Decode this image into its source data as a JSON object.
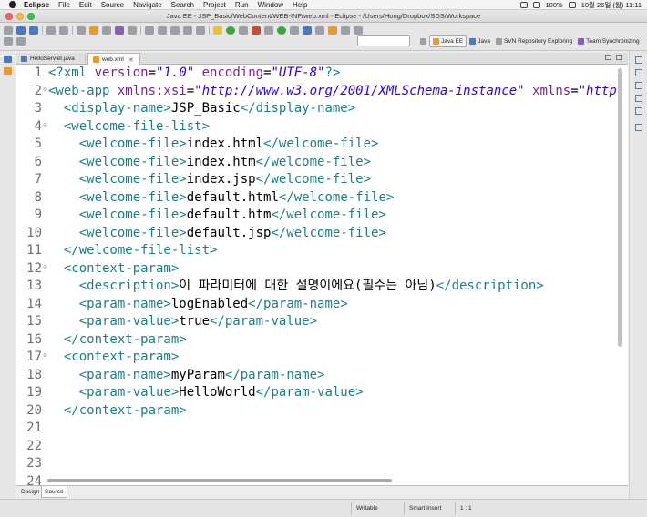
{
  "menubar": {
    "app_name": "Eclipse",
    "items": [
      "File",
      "Edit",
      "Source",
      "Navigate",
      "Search",
      "Project",
      "Run",
      "Window",
      "Help"
    ],
    "battery": "100%",
    "datetime": "10월 26일 (월)  11:11"
  },
  "window": {
    "title": "Java EE - JSP_Basic/WebContent/WEB-INF/web.xml - Eclipse - /Users/Hong/Dropbox/SDS/Workspace"
  },
  "perspectives": [
    {
      "label": "Java EE",
      "active": true
    },
    {
      "label": "Java",
      "active": false
    },
    {
      "label": "SVN Repository Exploring",
      "active": false
    },
    {
      "label": "Team Synchronizing",
      "active": false
    }
  ],
  "tabs": [
    {
      "label": "HelloServlet.java",
      "active": false
    },
    {
      "label": "web.xml",
      "active": true
    }
  ],
  "editor": {
    "lines": [
      {
        "num": "1",
        "fold": "",
        "tokens": [
          [
            "pi",
            "<?xml "
          ],
          [
            "an",
            "version"
          ],
          [
            "txt",
            "="
          ],
          [
            "av",
            "\"1.0\""
          ],
          [
            "txt",
            " "
          ],
          [
            "an",
            "encoding"
          ],
          [
            "txt",
            "="
          ],
          [
            "av",
            "\"UTF-8\""
          ],
          [
            "pi",
            "?>"
          ]
        ]
      },
      {
        "num": "2",
        "fold": "⊖",
        "tokens": [
          [
            "tg",
            "<web-app "
          ],
          [
            "an",
            "xmlns:xsi"
          ],
          [
            "txt",
            "="
          ],
          [
            "av",
            "\"http://www.w3.org/2001/XMLSchema-instance\""
          ],
          [
            "txt",
            " "
          ],
          [
            "an",
            "xmlns"
          ],
          [
            "txt",
            "="
          ],
          [
            "av",
            "\"http"
          ]
        ]
      },
      {
        "num": "3",
        "fold": "",
        "tokens": [
          [
            "txt",
            "  "
          ],
          [
            "tg",
            "<display-name>"
          ],
          [
            "txt",
            "JSP_Basic"
          ],
          [
            "tg",
            "</display-name>"
          ]
        ]
      },
      {
        "num": "4",
        "fold": "⊖",
        "tokens": [
          [
            "txt",
            "  "
          ],
          [
            "tg",
            "<welcome-file-list>"
          ]
        ]
      },
      {
        "num": "5",
        "fold": "",
        "tokens": [
          [
            "txt",
            "    "
          ],
          [
            "tg",
            "<welcome-file>"
          ],
          [
            "txt",
            "index.html"
          ],
          [
            "tg",
            "</welcome-file>"
          ]
        ]
      },
      {
        "num": "6",
        "fold": "",
        "tokens": [
          [
            "txt",
            "    "
          ],
          [
            "tg",
            "<welcome-file>"
          ],
          [
            "txt",
            "index.htm"
          ],
          [
            "tg",
            "</welcome-file>"
          ]
        ]
      },
      {
        "num": "7",
        "fold": "",
        "tokens": [
          [
            "txt",
            "    "
          ],
          [
            "tg",
            "<welcome-file>"
          ],
          [
            "txt",
            "index.jsp"
          ],
          [
            "tg",
            "</welcome-file>"
          ]
        ]
      },
      {
        "num": "8",
        "fold": "",
        "tokens": [
          [
            "txt",
            "    "
          ],
          [
            "tg",
            "<welcome-file>"
          ],
          [
            "txt",
            "default.html"
          ],
          [
            "tg",
            "</welcome-file>"
          ]
        ]
      },
      {
        "num": "9",
        "fold": "",
        "tokens": [
          [
            "txt",
            "    "
          ],
          [
            "tg",
            "<welcome-file>"
          ],
          [
            "txt",
            "default.htm"
          ],
          [
            "tg",
            "</welcome-file>"
          ]
        ]
      },
      {
        "num": "10",
        "fold": "",
        "tokens": [
          [
            "txt",
            "    "
          ],
          [
            "tg",
            "<welcome-file>"
          ],
          [
            "txt",
            "default.jsp"
          ],
          [
            "tg",
            "</welcome-file>"
          ]
        ]
      },
      {
        "num": "11",
        "fold": "",
        "tokens": [
          [
            "txt",
            "  "
          ],
          [
            "tg",
            "</welcome-file-list>"
          ]
        ]
      },
      {
        "num": "12",
        "fold": "⊖",
        "tokens": [
          [
            "txt",
            "  "
          ],
          [
            "tg",
            "<context-param>"
          ]
        ]
      },
      {
        "num": "13",
        "fold": "",
        "tokens": [
          [
            "txt",
            "    "
          ],
          [
            "tg",
            "<description>"
          ],
          [
            "txt",
            "이 파라미터에 대한 설명이에요(필수는 아님)"
          ],
          [
            "tg",
            "</description>"
          ]
        ]
      },
      {
        "num": "14",
        "fold": "",
        "tokens": [
          [
            "txt",
            "    "
          ],
          [
            "tg",
            "<param-name>"
          ],
          [
            "txt",
            "logEnabled"
          ],
          [
            "tg",
            "</param-name>"
          ]
        ]
      },
      {
        "num": "15",
        "fold": "",
        "tokens": [
          [
            "txt",
            "    "
          ],
          [
            "tg",
            "<param-value>"
          ],
          [
            "txt",
            "true"
          ],
          [
            "tg",
            "</param-value>"
          ]
        ]
      },
      {
        "num": "16",
        "fold": "",
        "tokens": [
          [
            "txt",
            "  "
          ],
          [
            "tg",
            "</context-param>"
          ]
        ]
      },
      {
        "num": "17",
        "fold": "⊖",
        "tokens": [
          [
            "txt",
            "  "
          ],
          [
            "tg",
            "<context-param>"
          ]
        ]
      },
      {
        "num": "18",
        "fold": "",
        "tokens": [
          [
            "txt",
            "    "
          ],
          [
            "tg",
            "<param-name>"
          ],
          [
            "txt",
            "myParam"
          ],
          [
            "tg",
            "</param-name>"
          ]
        ]
      },
      {
        "num": "19",
        "fold": "",
        "tokens": [
          [
            "txt",
            "    "
          ],
          [
            "tg",
            "<param-value>"
          ],
          [
            "txt",
            "HelloWorld"
          ],
          [
            "tg",
            "</param-value>"
          ]
        ]
      },
      {
        "num": "20",
        "fold": "",
        "tokens": [
          [
            "txt",
            "  "
          ],
          [
            "tg",
            "</context-param>"
          ]
        ]
      },
      {
        "num": "21",
        "fold": "",
        "tokens": []
      },
      {
        "num": "22",
        "fold": "",
        "tokens": []
      },
      {
        "num": "23",
        "fold": "",
        "tokens": []
      },
      {
        "num": "24",
        "fold": "",
        "tokens": []
      }
    ]
  },
  "bottom_tabs": [
    {
      "label": "Design",
      "active": false
    },
    {
      "label": "Source",
      "active": true
    }
  ],
  "status": {
    "mode": "Writable",
    "insert": "Smart Insert",
    "position": "1 : 1"
  },
  "colors": {
    "tag": "#1b7e86",
    "attribute": "#7a2490",
    "attr_value": "#2a00ff",
    "text": "#000000"
  }
}
